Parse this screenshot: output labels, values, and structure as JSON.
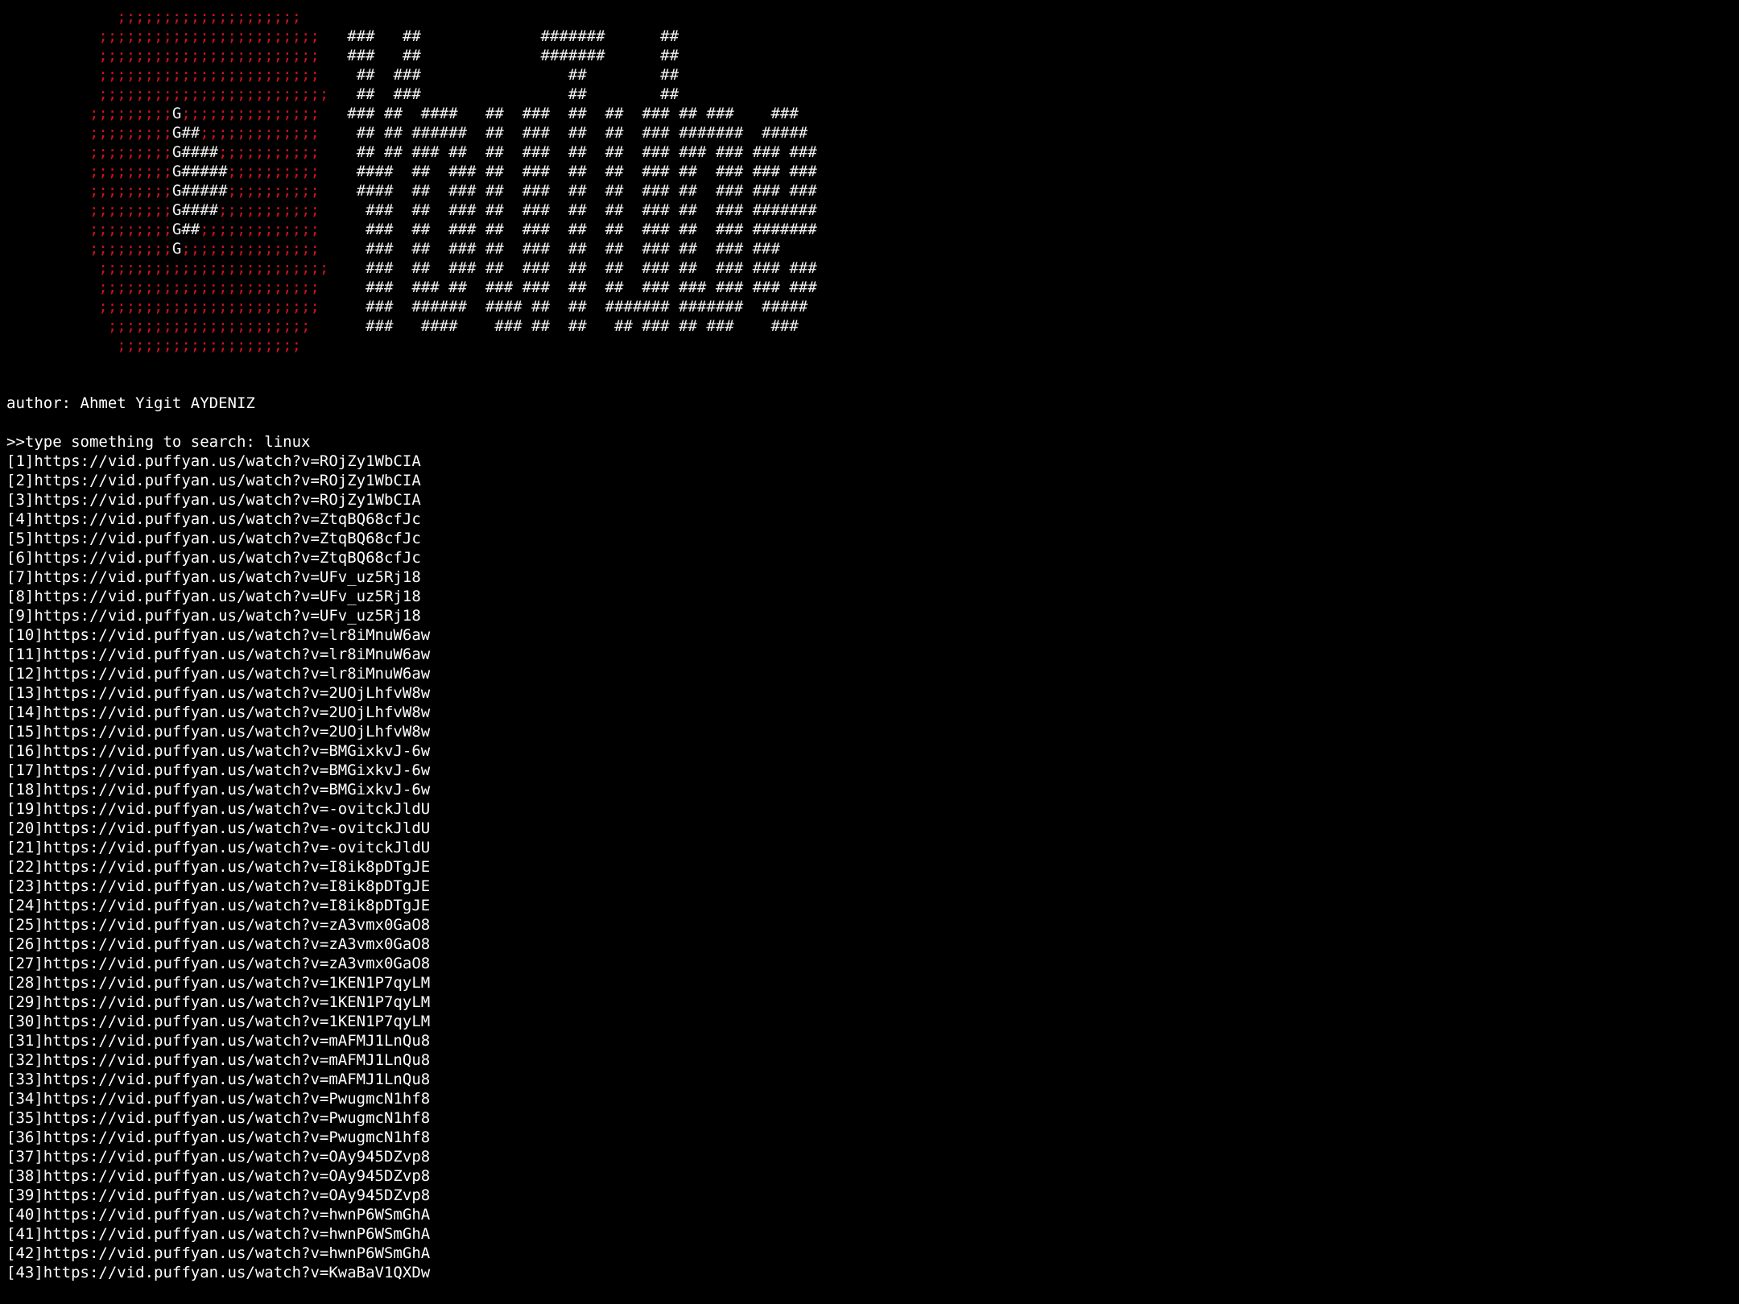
{
  "banner": [
    [
      [
        "red",
        "            ;;;;;;;;;;;;;;;;;;;;"
      ]
    ],
    [
      [
        "red",
        "          ;;;;;;;;;;;;;;;;;;;;;;;;"
      ],
      [
        "wht",
        "   ###   ##             #######      ##"
      ]
    ],
    [
      [
        "red",
        "          ;;;;;;;;;;;;;;;;;;;;;;;;"
      ],
      [
        "wht",
        "   ###   ##             #######      ##"
      ]
    ],
    [
      [
        "red",
        "          ;;;;;;;;;;;;;;;;;;;;;;;;"
      ],
      [
        "wht",
        "    ##  ###                ##        ##"
      ]
    ],
    [
      [
        "red",
        "          ;;;;;;;;;;;;;;;;;;;;;;;;;"
      ],
      [
        "wht",
        "   ##  ###                ##        ##"
      ]
    ],
    [
      [
        "red",
        "         ;;;;;;;;;"
      ],
      [
        "wht",
        "G"
      ],
      [
        "red",
        ";;;;;;;;;;;;;;;"
      ],
      [
        "wht",
        "   ### ##  ####   ##  ###  ##  ##  ### ## ###    ###"
      ]
    ],
    [
      [
        "red",
        "         ;;;;;;;;;"
      ],
      [
        "wht",
        "G##"
      ],
      [
        "red",
        ";;;;;;;;;;;;;"
      ],
      [
        "wht",
        "    ## ## ######  ##  ###  ##  ##  ### #######  #####"
      ]
    ],
    [
      [
        "red",
        "         ;;;;;;;;;"
      ],
      [
        "wht",
        "G####"
      ],
      [
        "red",
        ";;;;;;;;;;;"
      ],
      [
        "wht",
        "    ## ## ### ##  ##  ###  ##  ##  ### ### ### ### ###"
      ]
    ],
    [
      [
        "red",
        "         ;;;;;;;;;"
      ],
      [
        "wht",
        "G#####"
      ],
      [
        "red",
        ";;;;;;;;;;"
      ],
      [
        "wht",
        "    ####  ##  ### ##  ###  ##  ##  ### ##  ### ### ###"
      ]
    ],
    [
      [
        "red",
        "         ;;;;;;;;;"
      ],
      [
        "wht",
        "G#####"
      ],
      [
        "red",
        ";;;;;;;;;;"
      ],
      [
        "wht",
        "    ####  ##  ### ##  ###  ##  ##  ### ##  ### ### ###"
      ]
    ],
    [
      [
        "red",
        "         ;;;;;;;;;"
      ],
      [
        "wht",
        "G####"
      ],
      [
        "red",
        ";;;;;;;;;;;"
      ],
      [
        "wht",
        "     ###  ##  ### ##  ###  ##  ##  ### ##  ### #######"
      ]
    ],
    [
      [
        "red",
        "         ;;;;;;;;;"
      ],
      [
        "wht",
        "G##"
      ],
      [
        "red",
        ";;;;;;;;;;;;;"
      ],
      [
        "wht",
        "     ###  ##  ### ##  ###  ##  ##  ### ##  ### #######"
      ]
    ],
    [
      [
        "red",
        "         ;;;;;;;;;"
      ],
      [
        "wht",
        "G"
      ],
      [
        "red",
        ";;;;;;;;;;;;;;;"
      ],
      [
        "wht",
        "     ###  ##  ### ##  ###  ##  ##  ### ##  ### ###"
      ]
    ],
    [
      [
        "red",
        "          ;;;;;;;;;;;;;;;;;;;;;;;;;"
      ],
      [
        "wht",
        "    ###  ##  ### ##  ###  ##  ##  ### ##  ### ### ###"
      ]
    ],
    [
      [
        "red",
        "          ;;;;;;;;;;;;;;;;;;;;;;;;"
      ],
      [
        "wht",
        "     ###  ### ##  ### ###  ##  ##  ### ### ### ### ###"
      ]
    ],
    [
      [
        "red",
        "          ;;;;;;;;;;;;;;;;;;;;;;;;"
      ],
      [
        "wht",
        "     ###  ######  #### ##  ##  ####### #######  #####"
      ]
    ],
    [
      [
        "red",
        "           ;;;;;;;;;;;;;;;;;;;;;;"
      ],
      [
        "wht",
        "      ###   ####    ### ##  ##   ## ### ## ###    ###"
      ]
    ],
    [
      [
        "red",
        "            ;;;;;;;;;;;;;;;;;;;;"
      ]
    ]
  ],
  "author_line": "author: Ahmet Yigit AYDENIZ",
  "prompt_line": ">>type something to search: linux",
  "results": [
    "[1]https://vid.puffyan.us/watch?v=ROjZy1WbCIA",
    "[2]https://vid.puffyan.us/watch?v=ROjZy1WbCIA",
    "[3]https://vid.puffyan.us/watch?v=ROjZy1WbCIA",
    "[4]https://vid.puffyan.us/watch?v=ZtqBQ68cfJc",
    "[5]https://vid.puffyan.us/watch?v=ZtqBQ68cfJc",
    "[6]https://vid.puffyan.us/watch?v=ZtqBQ68cfJc",
    "[7]https://vid.puffyan.us/watch?v=UFv_uz5Rj18",
    "[8]https://vid.puffyan.us/watch?v=UFv_uz5Rj18",
    "[9]https://vid.puffyan.us/watch?v=UFv_uz5Rj18",
    "[10]https://vid.puffyan.us/watch?v=lr8iMnuW6aw",
    "[11]https://vid.puffyan.us/watch?v=lr8iMnuW6aw",
    "[12]https://vid.puffyan.us/watch?v=lr8iMnuW6aw",
    "[13]https://vid.puffyan.us/watch?v=2UOjLhfvW8w",
    "[14]https://vid.puffyan.us/watch?v=2UOjLhfvW8w",
    "[15]https://vid.puffyan.us/watch?v=2UOjLhfvW8w",
    "[16]https://vid.puffyan.us/watch?v=BMGixkvJ-6w",
    "[17]https://vid.puffyan.us/watch?v=BMGixkvJ-6w",
    "[18]https://vid.puffyan.us/watch?v=BMGixkvJ-6w",
    "[19]https://vid.puffyan.us/watch?v=-ovitckJldU",
    "[20]https://vid.puffyan.us/watch?v=-ovitckJldU",
    "[21]https://vid.puffyan.us/watch?v=-ovitckJldU",
    "[22]https://vid.puffyan.us/watch?v=I8ik8pDTgJE",
    "[23]https://vid.puffyan.us/watch?v=I8ik8pDTgJE",
    "[24]https://vid.puffyan.us/watch?v=I8ik8pDTgJE",
    "[25]https://vid.puffyan.us/watch?v=zA3vmx0GaO8",
    "[26]https://vid.puffyan.us/watch?v=zA3vmx0GaO8",
    "[27]https://vid.puffyan.us/watch?v=zA3vmx0GaO8",
    "[28]https://vid.puffyan.us/watch?v=1KEN1P7qyLM",
    "[29]https://vid.puffyan.us/watch?v=1KEN1P7qyLM",
    "[30]https://vid.puffyan.us/watch?v=1KEN1P7qyLM",
    "[31]https://vid.puffyan.us/watch?v=mAFMJ1LnQu8",
    "[32]https://vid.puffyan.us/watch?v=mAFMJ1LnQu8",
    "[33]https://vid.puffyan.us/watch?v=mAFMJ1LnQu8",
    "[34]https://vid.puffyan.us/watch?v=PwugmcN1hf8",
    "[35]https://vid.puffyan.us/watch?v=PwugmcN1hf8",
    "[36]https://vid.puffyan.us/watch?v=PwugmcN1hf8",
    "[37]https://vid.puffyan.us/watch?v=OAy945DZvp8",
    "[38]https://vid.puffyan.us/watch?v=OAy945DZvp8",
    "[39]https://vid.puffyan.us/watch?v=OAy945DZvp8",
    "[40]https://vid.puffyan.us/watch?v=hwnP6WSmGhA",
    "[41]https://vid.puffyan.us/watch?v=hwnP6WSmGhA",
    "[42]https://vid.puffyan.us/watch?v=hwnP6WSmGhA",
    "[43]https://vid.puffyan.us/watch?v=KwaBaV1QXDw"
  ],
  "colors": {
    "background": "#000000",
    "text": "#ffffff",
    "logo_red": "#d1111b"
  }
}
